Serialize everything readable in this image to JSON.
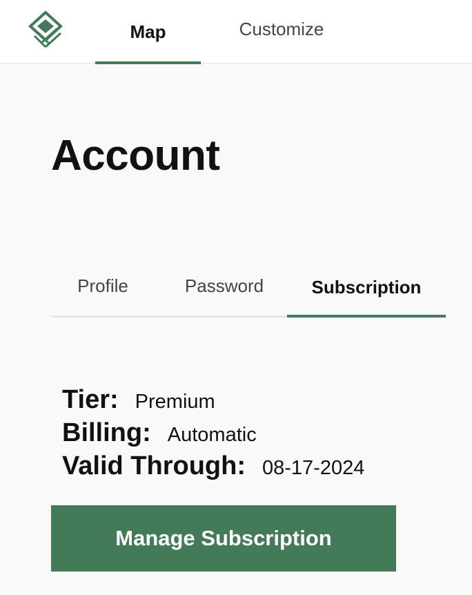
{
  "theme": {
    "accent": "#437a57"
  },
  "header": {
    "logo_icon": "layers-logo-icon",
    "tabs": [
      {
        "label": "Map",
        "active": true
      },
      {
        "label": "Customize",
        "active": false
      }
    ]
  },
  "page": {
    "title": "Account"
  },
  "account_tabs": [
    {
      "label": "Profile",
      "active": false
    },
    {
      "label": "Password",
      "active": false
    },
    {
      "label": "Subscription",
      "active": true
    }
  ],
  "subscription": {
    "tier_label": "Tier:",
    "tier_value": "Premium",
    "billing_label": "Billing:",
    "billing_value": "Automatic",
    "valid_label": "Valid Through:",
    "valid_value": "08-17-2024",
    "manage_button": "Manage Subscription"
  }
}
